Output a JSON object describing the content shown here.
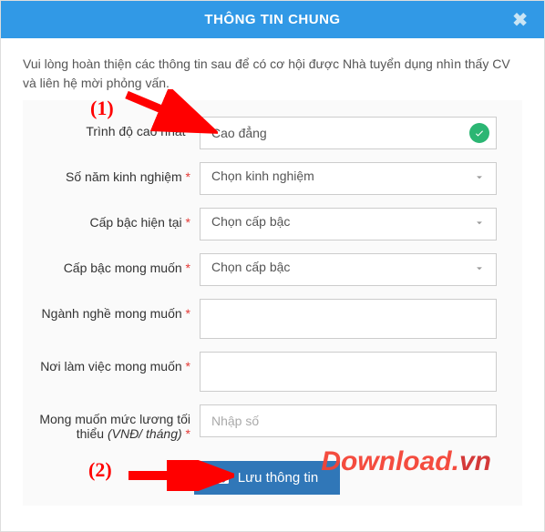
{
  "header": {
    "title": "THÔNG TIN CHUNG"
  },
  "intro": "Vui lòng hoàn thiện các thông tin sau để có cơ hội được Nhà tuyển dụng nhìn thấy CV và liên hệ mời phỏng vấn.",
  "fields": {
    "highest_degree": {
      "label": "Trình độ cao nhất",
      "value": "Cao đẳng"
    },
    "experience": {
      "label": "Số năm kinh nghiệm",
      "placeholder": "Chọn kinh nghiệm"
    },
    "current_level": {
      "label": "Cấp bậc hiện tại",
      "placeholder": "Chọn cấp bậc"
    },
    "desired_level": {
      "label": "Cấp bậc mong muốn",
      "placeholder": "Chọn cấp bậc"
    },
    "desired_industry": {
      "label": "Ngành nghề mong muốn",
      "value": ""
    },
    "desired_location": {
      "label": "Nơi làm việc mong muốn",
      "value": ""
    },
    "min_salary": {
      "label_main": "Mong muốn mức lương tối thiểu ",
      "label_sub": "(VNĐ/ tháng)",
      "placeholder": "Nhập số"
    }
  },
  "actions": {
    "save": "Lưu thông tin"
  },
  "annotations": {
    "a1": "(1)",
    "a2": "(2)"
  },
  "watermark": {
    "main": "Download",
    "dot": ".",
    "vn": "vn"
  }
}
